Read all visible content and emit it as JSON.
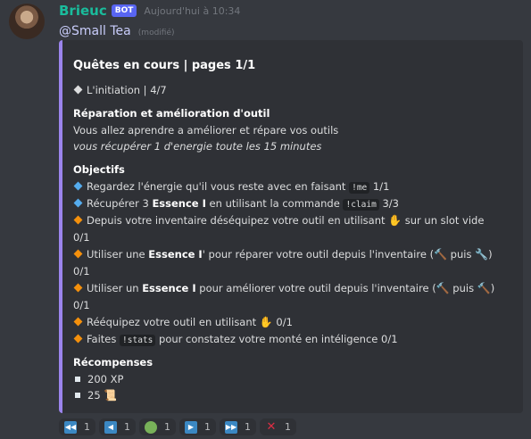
{
  "message": {
    "author": "Brieuc",
    "bot_tag": "BOT",
    "timestamp": "Aujourd'hui à 10:34",
    "mention": "@Small Tea",
    "edited": "(modifié)"
  },
  "embed": {
    "accent_color": "#9b84ec",
    "title": "Quêtes en cours | pages 1/1",
    "quest_line": "L'initiation | 4/7",
    "section_title": "Réparation et amélioration d'outil",
    "description": "Vous allez aprendre a améliorer et répare vos outils",
    "description_italic": "vous récupérer 1 d'energie toute les 15 minutes",
    "objectives_title": "Objectifs",
    "objectives": [
      {
        "status": "blue",
        "prefix": "Regardez l'énergie qu'il vous reste avec en faisant ",
        "code": "!me",
        "suffix": " 1/1"
      },
      {
        "status": "blue",
        "prefix": "Récupérer 3 ",
        "bold": "Essence I",
        "middle": " en utilisant la commande ",
        "code": "!claim",
        "suffix": " 3/3"
      },
      {
        "status": "orange",
        "prefix": "Depuis votre inventaire déséquipez votre outil en utilisant ",
        "suffix": " sur un slot vide",
        "continuation": "0/1"
      },
      {
        "status": "orange",
        "prefix": "Utiliser une ",
        "bold": "Essence I",
        "middle": "' pour réparer votre outil depuis l'inventaire (",
        "mid2": " puis ",
        "suffix": ")",
        "continuation": "0/1"
      },
      {
        "status": "orange",
        "prefix": "Utiliser un ",
        "bold": "Essence I",
        "middle": " pour améliorer votre outil depuis l'inventaire (",
        "mid2": " puis ",
        "suffix": ")",
        "continuation": "0/1"
      },
      {
        "status": "orange",
        "prefix": "Rééquipez votre outil en utilisant ",
        "suffix": " 0/1"
      },
      {
        "status": "orange",
        "prefix": "Faites ",
        "code": "!stats",
        "suffix": " pour constatez votre monté en intéligence 0/1"
      }
    ],
    "rewards_title": "Récompenses",
    "rewards": [
      "200 XP",
      "25"
    ]
  },
  "icons": {
    "hand": "raised-hand-icon",
    "hammer": "hammer-icon",
    "wrench": "wrench-icon",
    "scroll": "scroll-icon"
  },
  "reactions": [
    {
      "icon": "first-page-icon",
      "count": "1"
    },
    {
      "icon": "previous-page-icon",
      "count": "1"
    },
    {
      "icon": "green-circle-icon",
      "count": "1"
    },
    {
      "icon": "next-page-icon",
      "count": "1"
    },
    {
      "icon": "last-page-icon",
      "count": "1"
    },
    {
      "icon": "cross-mark-icon",
      "count": "1"
    }
  ]
}
